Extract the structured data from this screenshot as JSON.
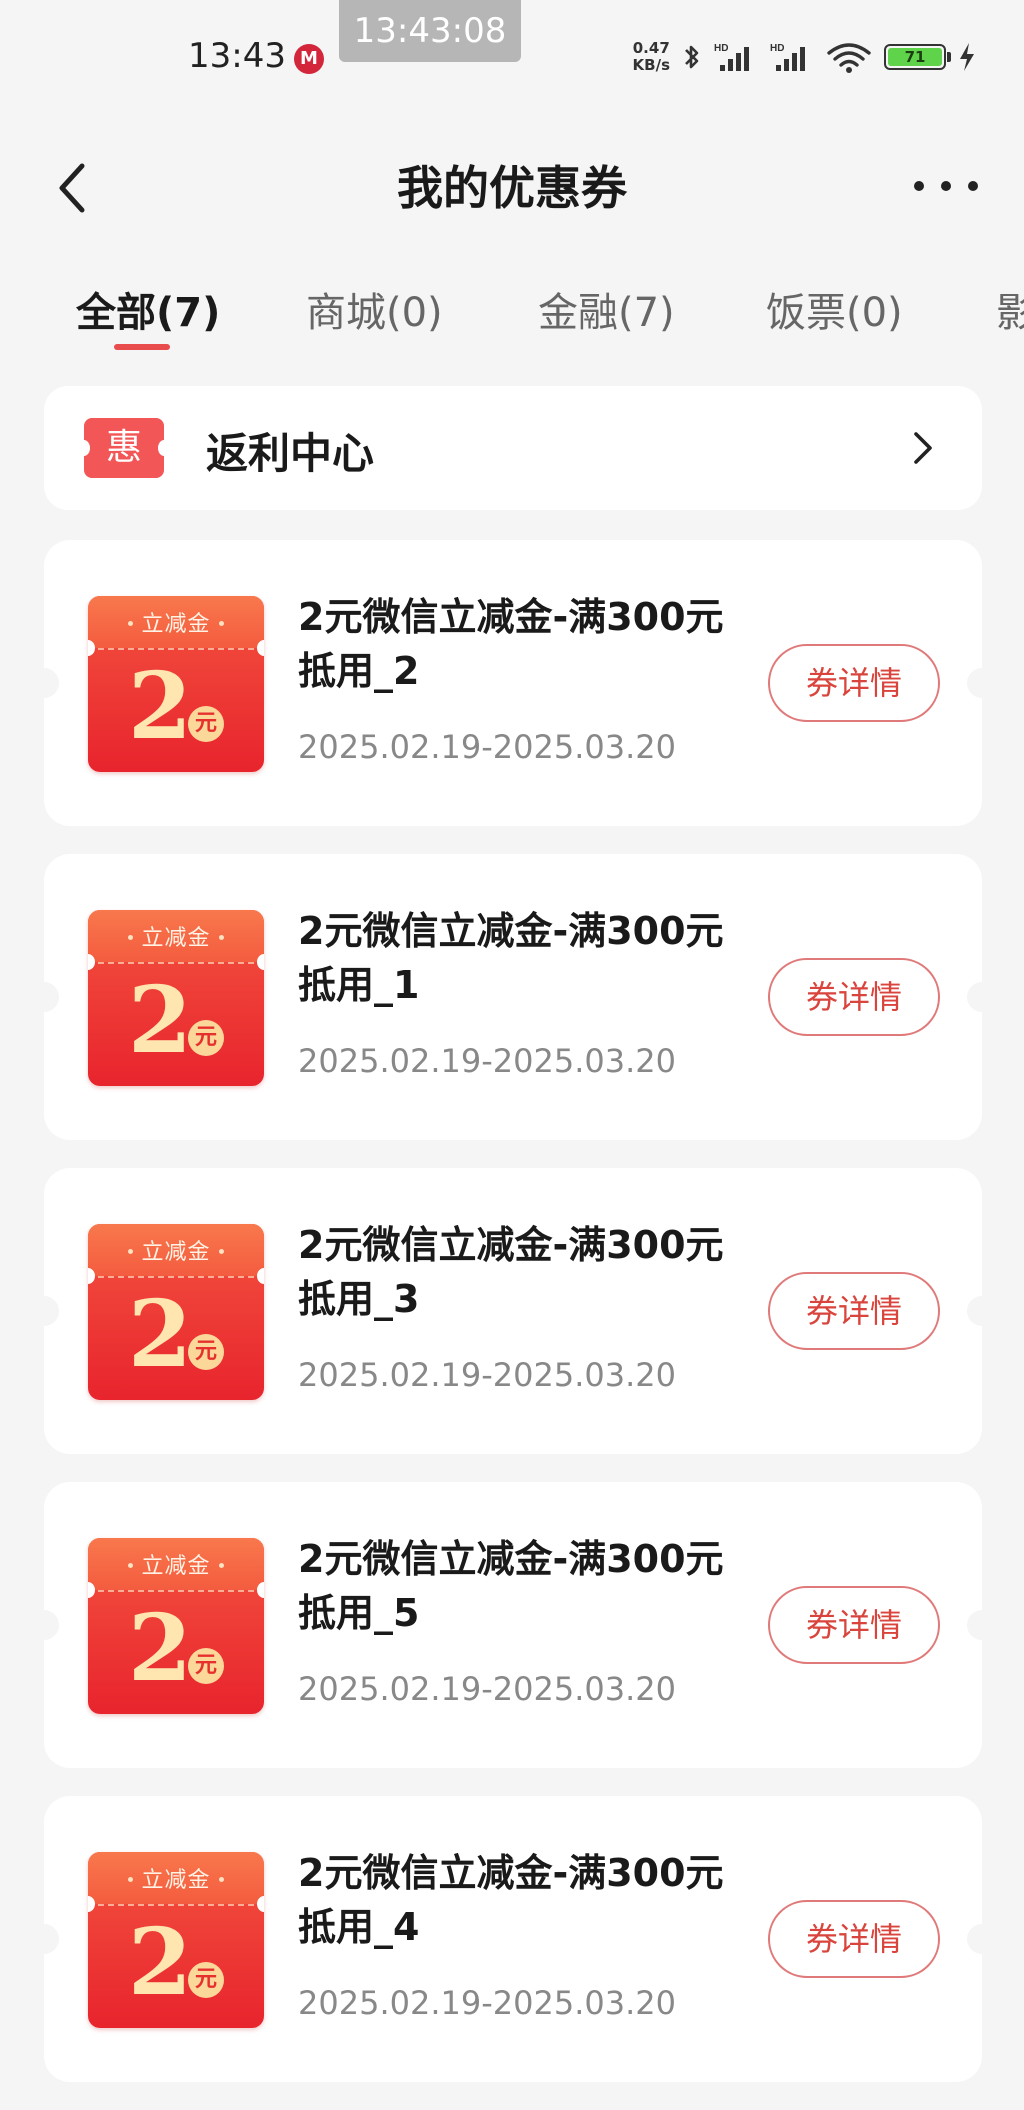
{
  "status_bar": {
    "time": "13:43",
    "bank_icon_text": "M",
    "more_dots": "···",
    "screenshot_time": "13:43:08",
    "net_speed_value": "0.47",
    "net_speed_unit": "KB/s",
    "battery": "71"
  },
  "header": {
    "title": "我的优惠券"
  },
  "tabs": [
    {
      "label": "全部(7)",
      "active": true
    },
    {
      "label": "商城(0)",
      "active": false
    },
    {
      "label": "金融(7)",
      "active": false
    },
    {
      "label": "饭票(0)",
      "active": false
    },
    {
      "label": "影",
      "active": false
    }
  ],
  "rebate_center": {
    "badge": "惠",
    "label": "返利中心"
  },
  "coupons": [
    {
      "badge_label": "立减金",
      "amount": "2",
      "unit": "元",
      "title": "2元微信立减金-满300元抵用_2",
      "validity": "2025.02.19-2025.03.20",
      "button": "券详情"
    },
    {
      "badge_label": "立减金",
      "amount": "2",
      "unit": "元",
      "title": "2元微信立减金-满300元抵用_1",
      "validity": "2025.02.19-2025.03.20",
      "button": "券详情"
    },
    {
      "badge_label": "立减金",
      "amount": "2",
      "unit": "元",
      "title": "2元微信立减金-满300元抵用_3",
      "validity": "2025.02.19-2025.03.20",
      "button": "券详情"
    },
    {
      "badge_label": "立减金",
      "amount": "2",
      "unit": "元",
      "title": "2元微信立减金-满300元抵用_5",
      "validity": "2025.02.19-2025.03.20",
      "button": "券详情"
    },
    {
      "badge_label": "立减金",
      "amount": "2",
      "unit": "元",
      "title": "2元微信立减金-满300元抵用_4",
      "validity": "2025.02.19-2025.03.20",
      "button": "券详情"
    }
  ],
  "colors": {
    "accent": "#e84c4c",
    "coupon_red": "#e8242d",
    "button_text": "#d9443c",
    "background": "#f5f5f5"
  }
}
